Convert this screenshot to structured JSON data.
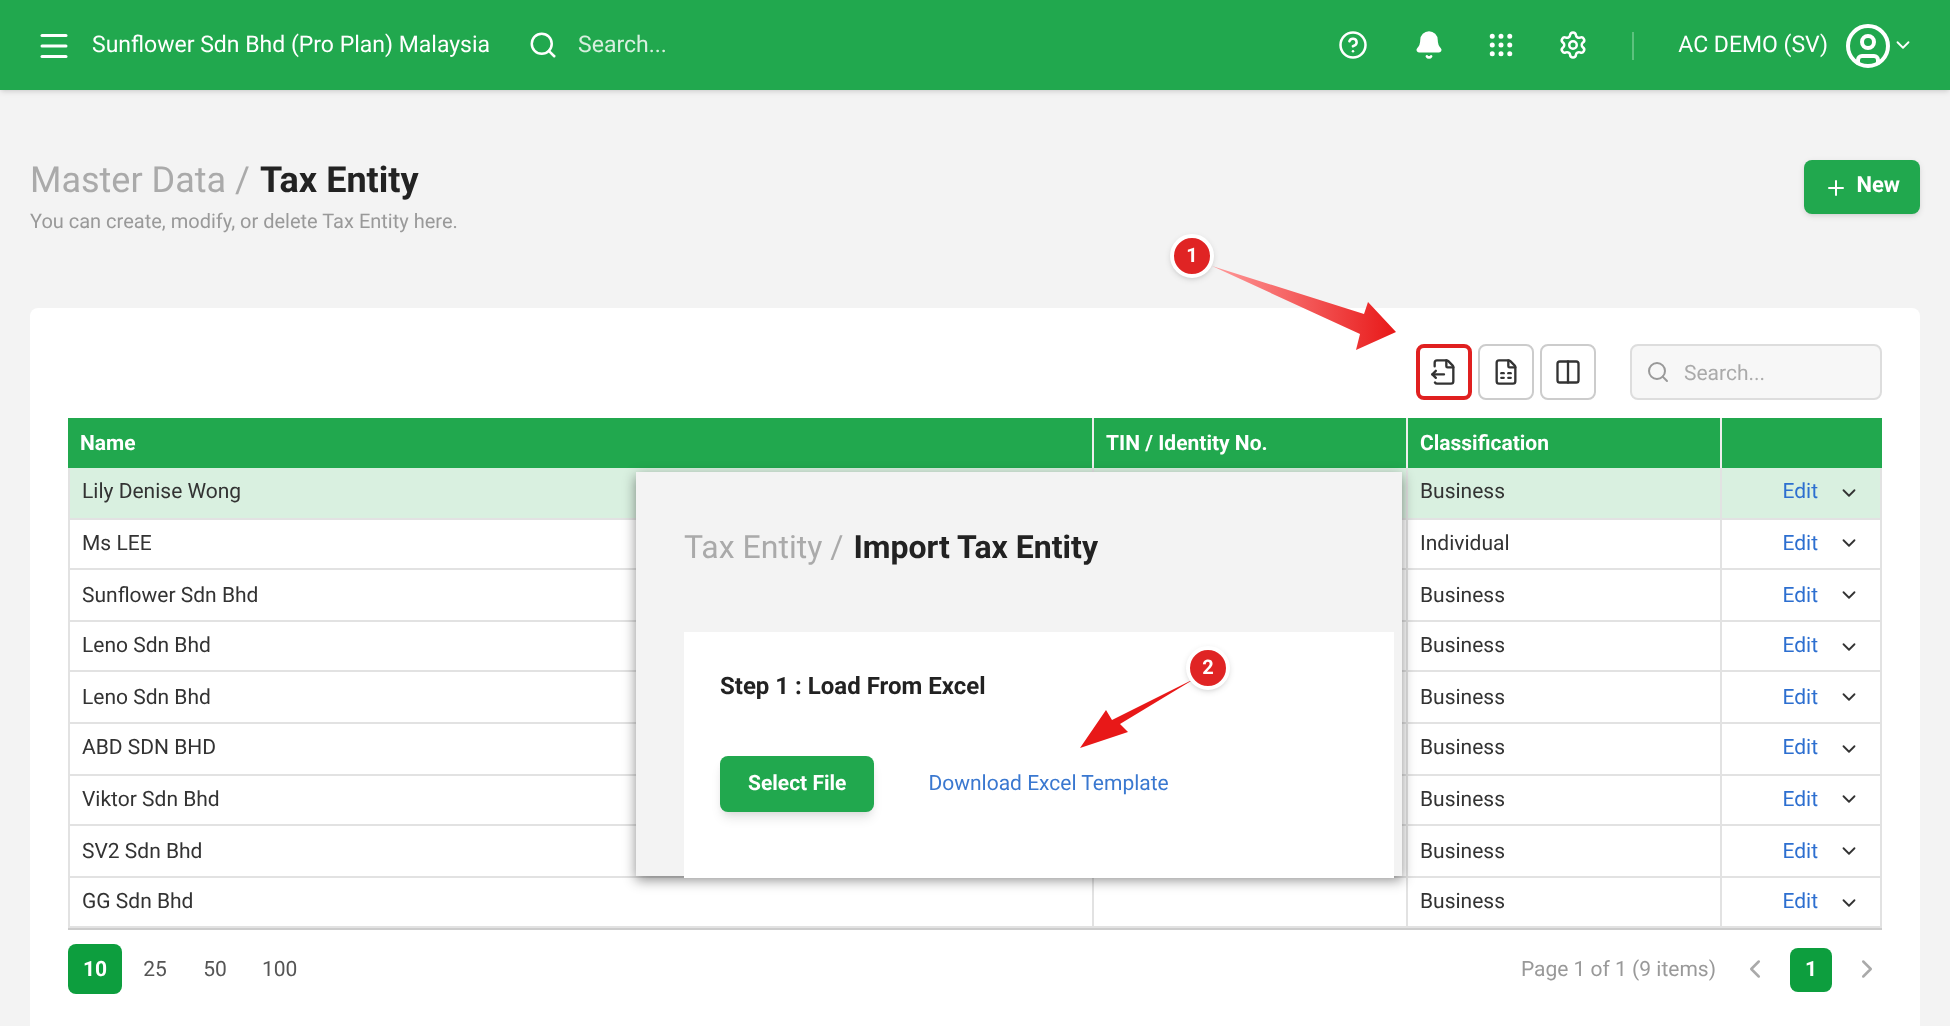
{
  "topbar": {
    "company": "Sunflower Sdn Bhd (Pro Plan) Malaysia",
    "search_placeholder": "Search...",
    "user": "AC DEMO (SV)"
  },
  "page": {
    "breadcrumb_parent": "Master Data /",
    "title": "Tax Entity",
    "subtitle": "You can create, modify, or delete Tax Entity here.",
    "new_button": "New"
  },
  "toolbar": {
    "search_placeholder": "Search...",
    "tools": [
      {
        "highlighted": true
      },
      {
        "highlighted": false
      },
      {
        "highlighted": false
      }
    ]
  },
  "table": {
    "columns": [
      "Name",
      "TIN / Identity No.",
      "Classification"
    ],
    "rows": [
      {
        "name": "Lily Denise Wong",
        "classification": "Business",
        "action": "Edit",
        "selected": true
      },
      {
        "name": "Ms LEE",
        "classification": "Individual",
        "action": "Edit",
        "selected": false
      },
      {
        "name": "Sunflower Sdn Bhd",
        "classification": "Business",
        "action": "Edit",
        "selected": false
      },
      {
        "name": "Leno Sdn Bhd",
        "classification": "Business",
        "action": "Edit",
        "selected": false
      },
      {
        "name": "Leno Sdn Bhd",
        "classification": "Business",
        "action": "Edit",
        "selected": false
      },
      {
        "name": "ABD SDN BHD",
        "classification": "Business",
        "action": "Edit",
        "selected": false
      },
      {
        "name": "Viktor Sdn Bhd",
        "classification": "Business",
        "action": "Edit",
        "selected": false
      },
      {
        "name": "SV2 Sdn Bhd",
        "classification": "Business",
        "action": "Edit",
        "selected": false
      },
      {
        "name": "GG Sdn Bhd",
        "classification": "Business",
        "action": "Edit",
        "selected": false
      }
    ]
  },
  "pagination": {
    "sizes": [
      {
        "label": "10",
        "selected": true
      },
      {
        "label": "25",
        "selected": false
      },
      {
        "label": "50",
        "selected": false
      },
      {
        "label": "100",
        "selected": false
      }
    ],
    "summary": "Page 1 of 1 (9 items)",
    "pages": [
      {
        "label": "1",
        "selected": true
      }
    ]
  },
  "dialog": {
    "breadcrumb_parent": "Tax Entity /",
    "title": "Import Tax Entity",
    "step_title": "Step 1 : Load From Excel",
    "select_button": "Select File",
    "template_link": "Download Excel Template"
  },
  "annotations": [
    {
      "label": "1"
    },
    {
      "label": "2"
    }
  ]
}
